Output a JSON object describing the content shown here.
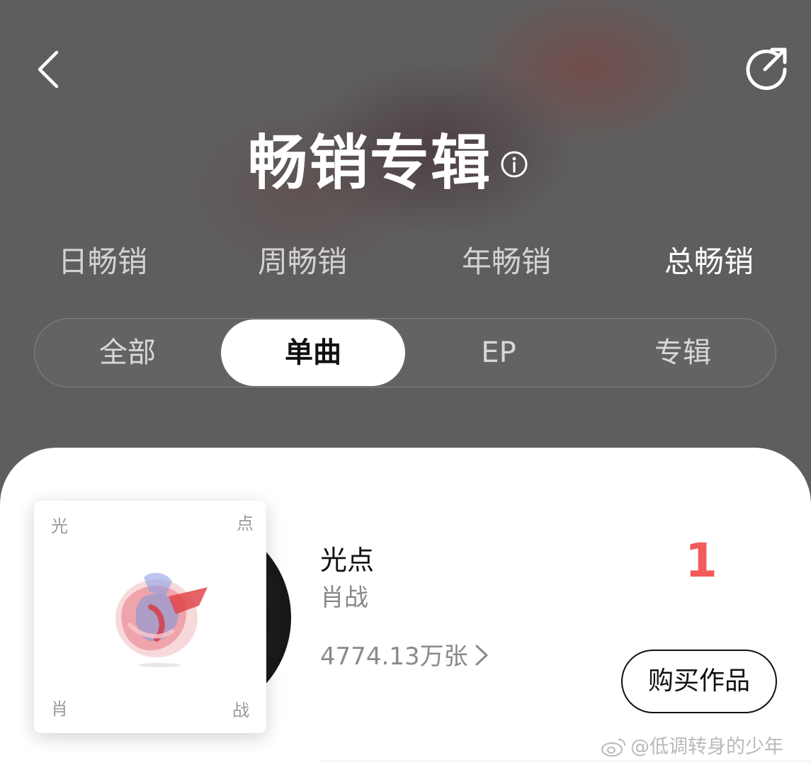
{
  "header": {
    "back_icon": "chevron-left-icon",
    "share_icon": "share-icon",
    "title": "畅销专辑",
    "info_icon": "info-icon"
  },
  "period_tabs": [
    {
      "label": "日畅销",
      "active": false
    },
    {
      "label": "周畅销",
      "active": false
    },
    {
      "label": "年畅销",
      "active": false
    },
    {
      "label": "总畅销",
      "active": true
    }
  ],
  "type_tabs": [
    {
      "label": "全部",
      "active": false
    },
    {
      "label": "单曲",
      "active": true
    },
    {
      "label": "EP",
      "active": false
    },
    {
      "label": "专辑",
      "active": false
    }
  ],
  "entry": {
    "cover": {
      "corner_top_left": "光",
      "corner_top_right": "点",
      "corner_bottom_left": "肖",
      "corner_bottom_right": "战"
    },
    "title": "光点",
    "artist": "肖战",
    "sales": "4774.13万张",
    "rank": "1",
    "buy_label": "购买作品"
  },
  "watermark": "@低调转身的少年",
  "colors": {
    "header_bg": "#5f5e5f",
    "rank_red": "#f35a5a",
    "card_bg": "#ffffff"
  }
}
